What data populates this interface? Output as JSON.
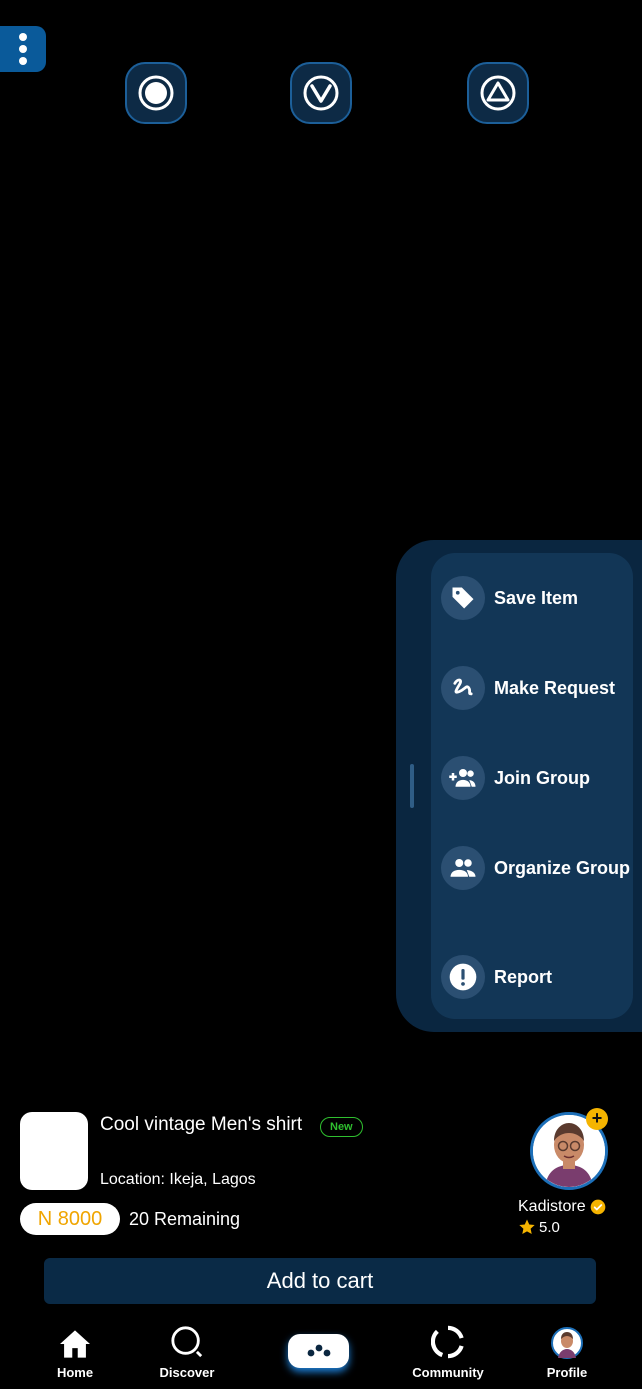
{
  "top_menu": {
    "icon": "more-vertical-icon"
  },
  "top_icons": [
    {
      "name": "record-icon"
    },
    {
      "name": "chevron-v-icon"
    },
    {
      "name": "triangle-icon"
    }
  ],
  "actions": [
    {
      "label": "Save Item",
      "icon": "tag-icon"
    },
    {
      "label": "Make Request",
      "icon": "squiggle-icon"
    },
    {
      "label": "Join Group",
      "icon": "group-add-icon"
    },
    {
      "label": "Organize Group",
      "icon": "group-icon"
    },
    {
      "label": "Report",
      "icon": "alert-icon"
    }
  ],
  "product": {
    "title": "Cool vintage Men's shirt",
    "badge": "New",
    "location": "Location: Ikeja, Lagos",
    "price": "N 8000",
    "remaining": "20 Remaining"
  },
  "seller": {
    "name": "Kadistore",
    "rating": "5.0",
    "plus": "+"
  },
  "cart": {
    "label": "Add to cart"
  },
  "nav": [
    {
      "label": "Home",
      "icon": "home-icon"
    },
    {
      "label": "Discover",
      "icon": "search-icon"
    },
    {
      "label": "",
      "icon": "gamepad-icon"
    },
    {
      "label": "Community",
      "icon": "community-icon"
    },
    {
      "label": "Profile",
      "icon": "avatar-icon"
    }
  ],
  "colors": {
    "accent": "#0a5a9a",
    "price": "#f0a500",
    "badge": "#2fbf2f",
    "star": "#f5b400"
  }
}
